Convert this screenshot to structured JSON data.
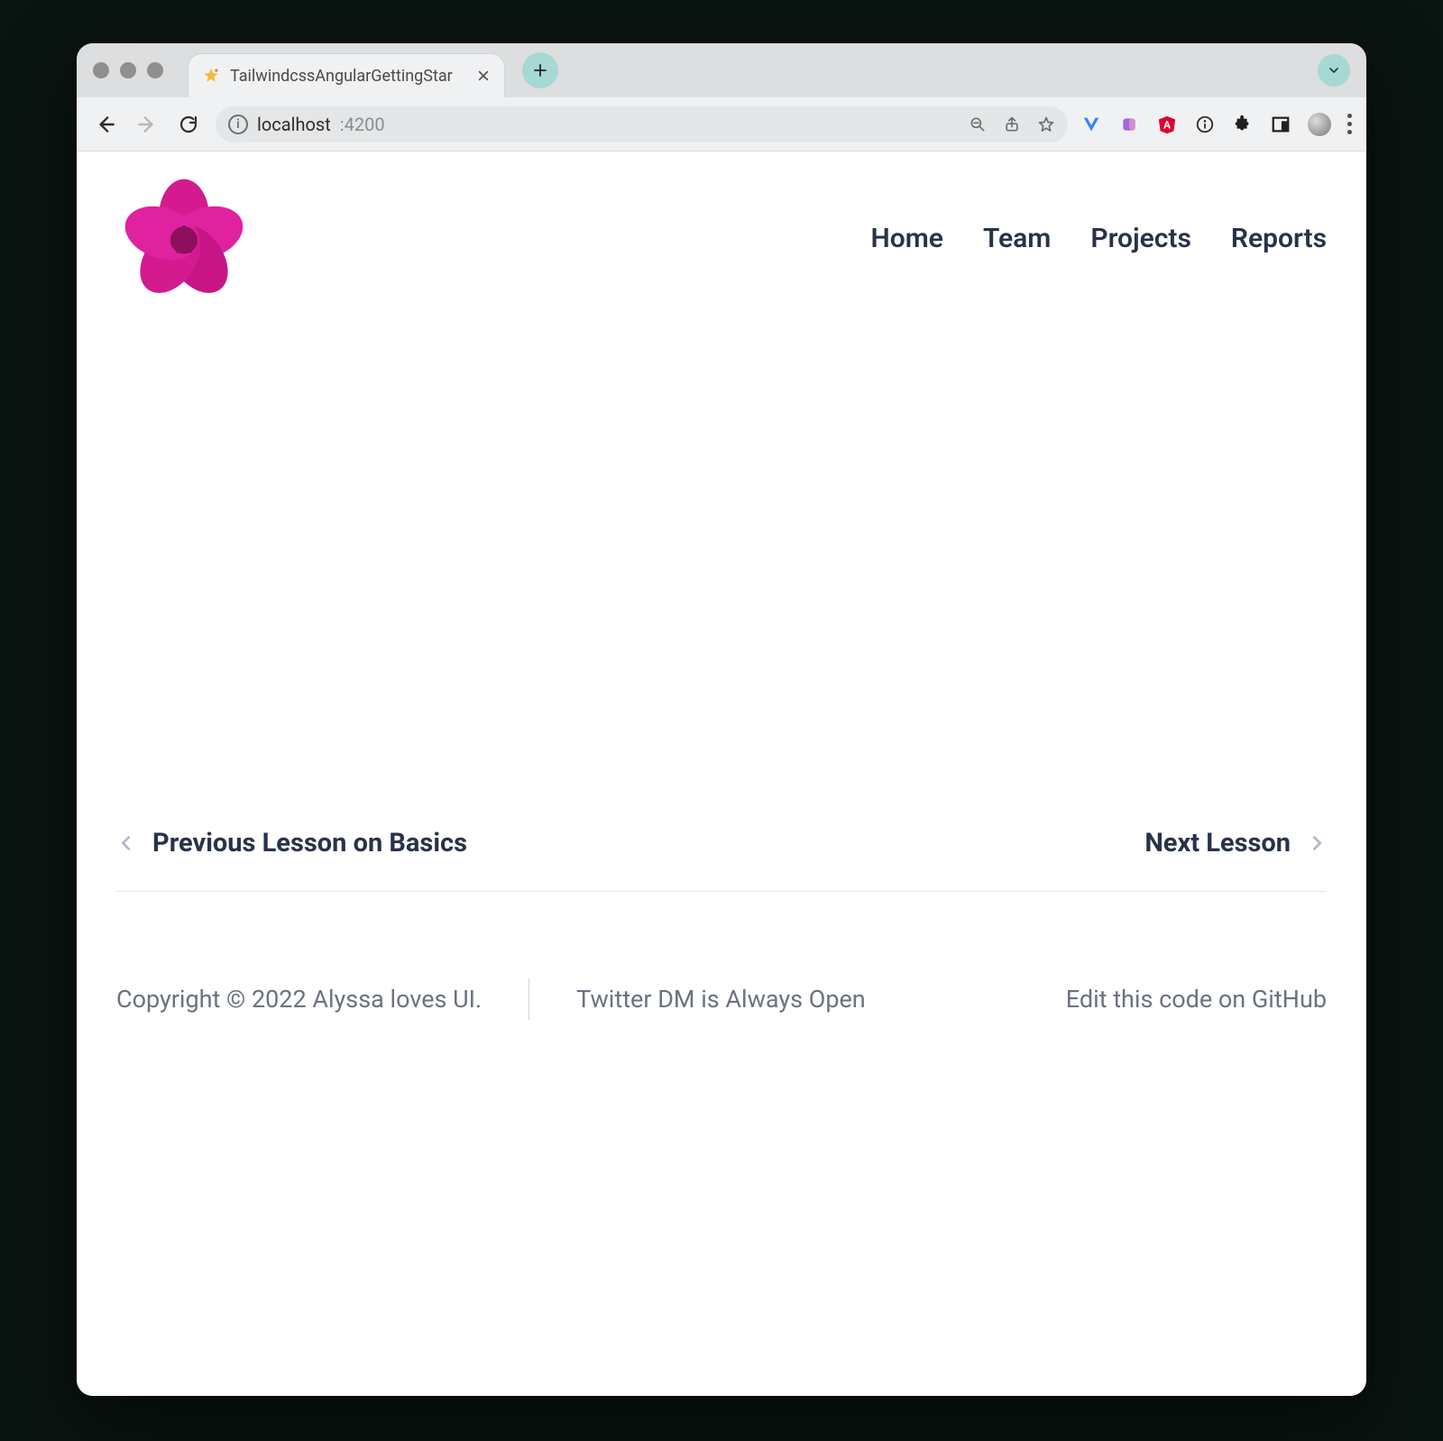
{
  "browser": {
    "tab_title": "TailwindcssAngularGettingStar",
    "url_host": "localhost",
    "url_port": ":4200"
  },
  "nav": {
    "items": [
      "Home",
      "Team",
      "Projects",
      "Reports"
    ]
  },
  "lesson_nav": {
    "prev": "Previous Lesson on Basics",
    "next": "Next Lesson"
  },
  "footer": {
    "copyright": "Copyright © 2022 Alyssa loves UI.",
    "twitter": "Twitter DM is Always Open",
    "github": "Edit this code on GitHub"
  }
}
